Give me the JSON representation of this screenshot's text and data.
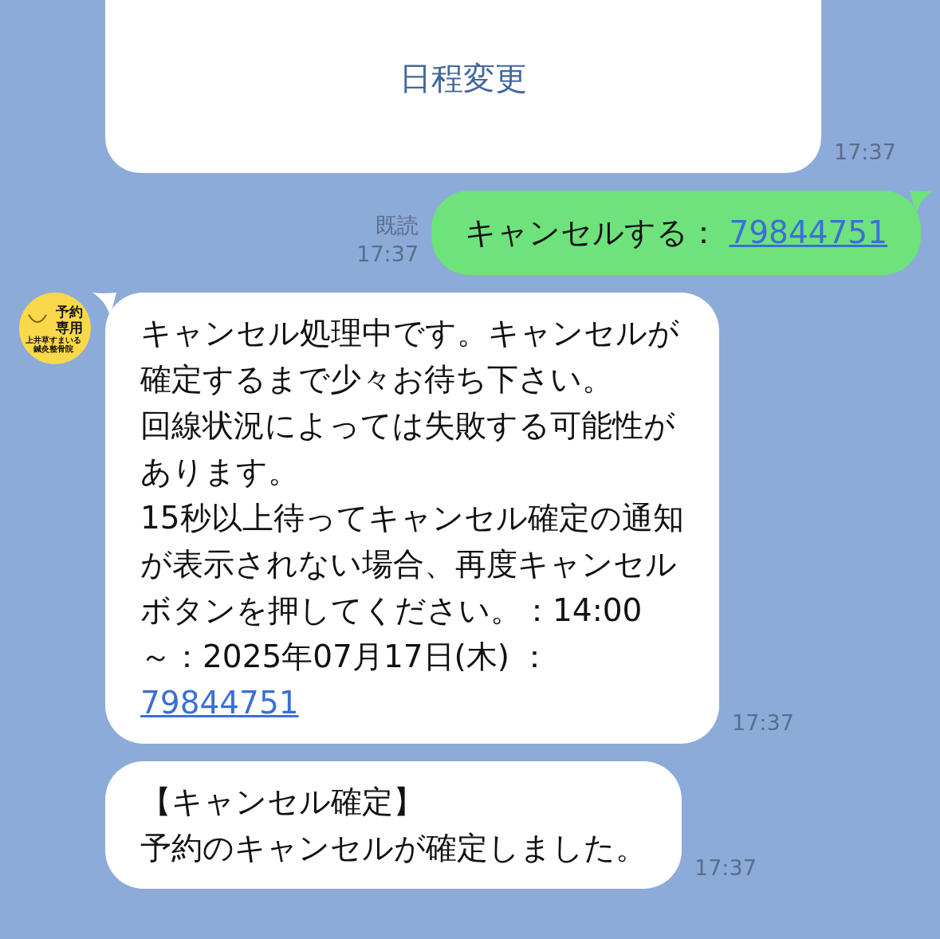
{
  "messages": [
    {
      "kind": "card",
      "button": "日程変更",
      "time": "17:37"
    },
    {
      "kind": "sent",
      "read": "既読",
      "time": "17:37",
      "paragraphs": [
        "キャンセルする： "
      ],
      "link": "79844751"
    },
    {
      "kind": "received",
      "avatar": {
        "title": [
          "予約",
          "専用"
        ],
        "caption": [
          "上井草すまいる",
          "鍼灸整骨院"
        ]
      },
      "tail": true,
      "time": "17:37",
      "paragraphs": [
        "キャンセル処理中です。キャンセルが確定するまで少々お待ち下さい。",
        "回線状況によっては失敗する可能性があります。",
        "15秒以上待ってキャンセル確定の通知が表示されない場合、再度キャンセルボタンを押してください。：14:00～：2025年07月17日(木) ："
      ],
      "link": "79844751"
    },
    {
      "kind": "received",
      "tail": false,
      "time": "17:37",
      "paragraphs": [
        "【キャンセル確定】",
        "予約のキャンセルが確定しました。"
      ]
    }
  ]
}
